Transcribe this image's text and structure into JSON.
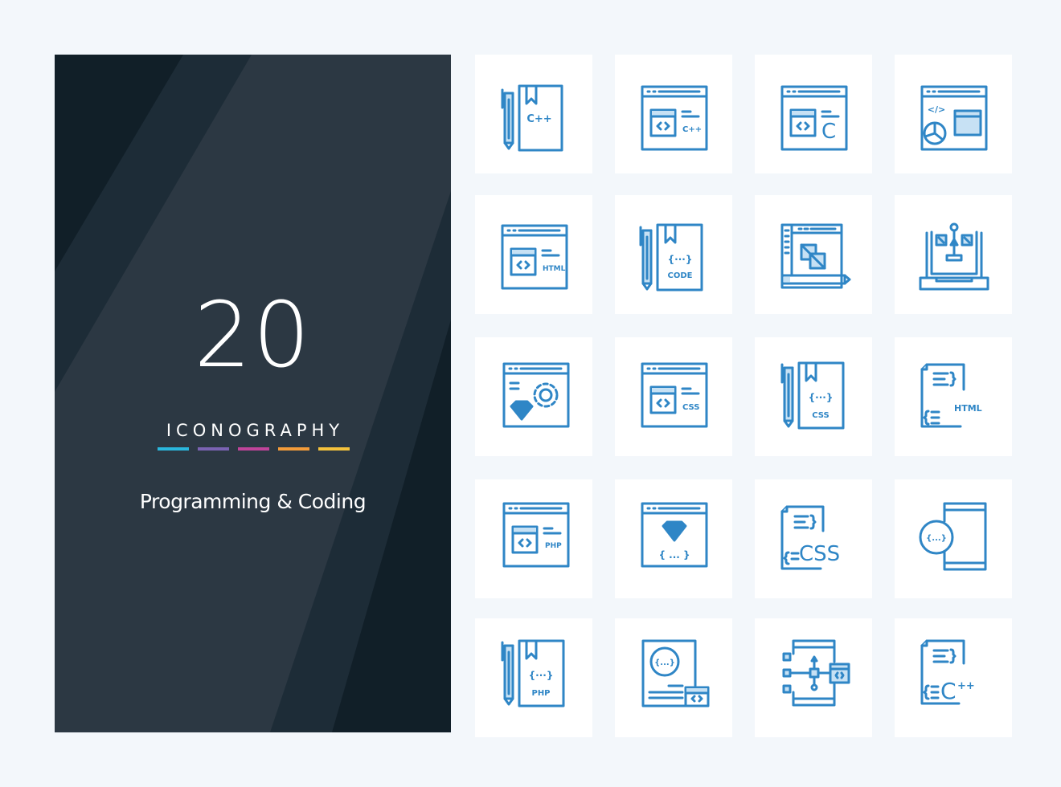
{
  "cover": {
    "count": "20",
    "subtitle": "ICONOGRAPHY",
    "title": "Programming & Coding",
    "accent_bars": [
      "#2ab7dd",
      "#7b63b3",
      "#c0449a",
      "#f39c3a",
      "#f4c23c"
    ],
    "background": "#2c3843"
  },
  "icon_color": "#2f86c6",
  "icons": [
    {
      "name": "cpp-book-pencil-icon",
      "label": "C++"
    },
    {
      "name": "cpp-browser-icon",
      "label": "C++"
    },
    {
      "name": "c-browser-icon",
      "label": "C"
    },
    {
      "name": "code-chart-browser-icon",
      "label": "</>"
    },
    {
      "name": "html-browser-icon",
      "label": "HTML"
    },
    {
      "name": "code-book-pencil-icon",
      "label": "CODE"
    },
    {
      "name": "design-editor-icon",
      "label": ""
    },
    {
      "name": "laptop-flowchart-icon",
      "label": ""
    },
    {
      "name": "gem-gear-browser-icon",
      "label": ""
    },
    {
      "name": "css-browser-icon",
      "label": "CSS"
    },
    {
      "name": "css-book-pencil-icon",
      "label": "CSS"
    },
    {
      "name": "html-file-icon",
      "label": "HTML"
    },
    {
      "name": "php-browser-icon",
      "label": "PHP"
    },
    {
      "name": "ruby-browser-icon",
      "label": "{ ... }"
    },
    {
      "name": "css-file-icon",
      "label": "CSS"
    },
    {
      "name": "mobile-code-icon",
      "label": "{...}"
    },
    {
      "name": "php-book-pencil-icon",
      "label": "PHP"
    },
    {
      "name": "code-document-icon",
      "label": "{...}"
    },
    {
      "name": "mobile-flowchart-icon",
      "label": ""
    },
    {
      "name": "cpp-file-icon",
      "label": "C++"
    }
  ]
}
